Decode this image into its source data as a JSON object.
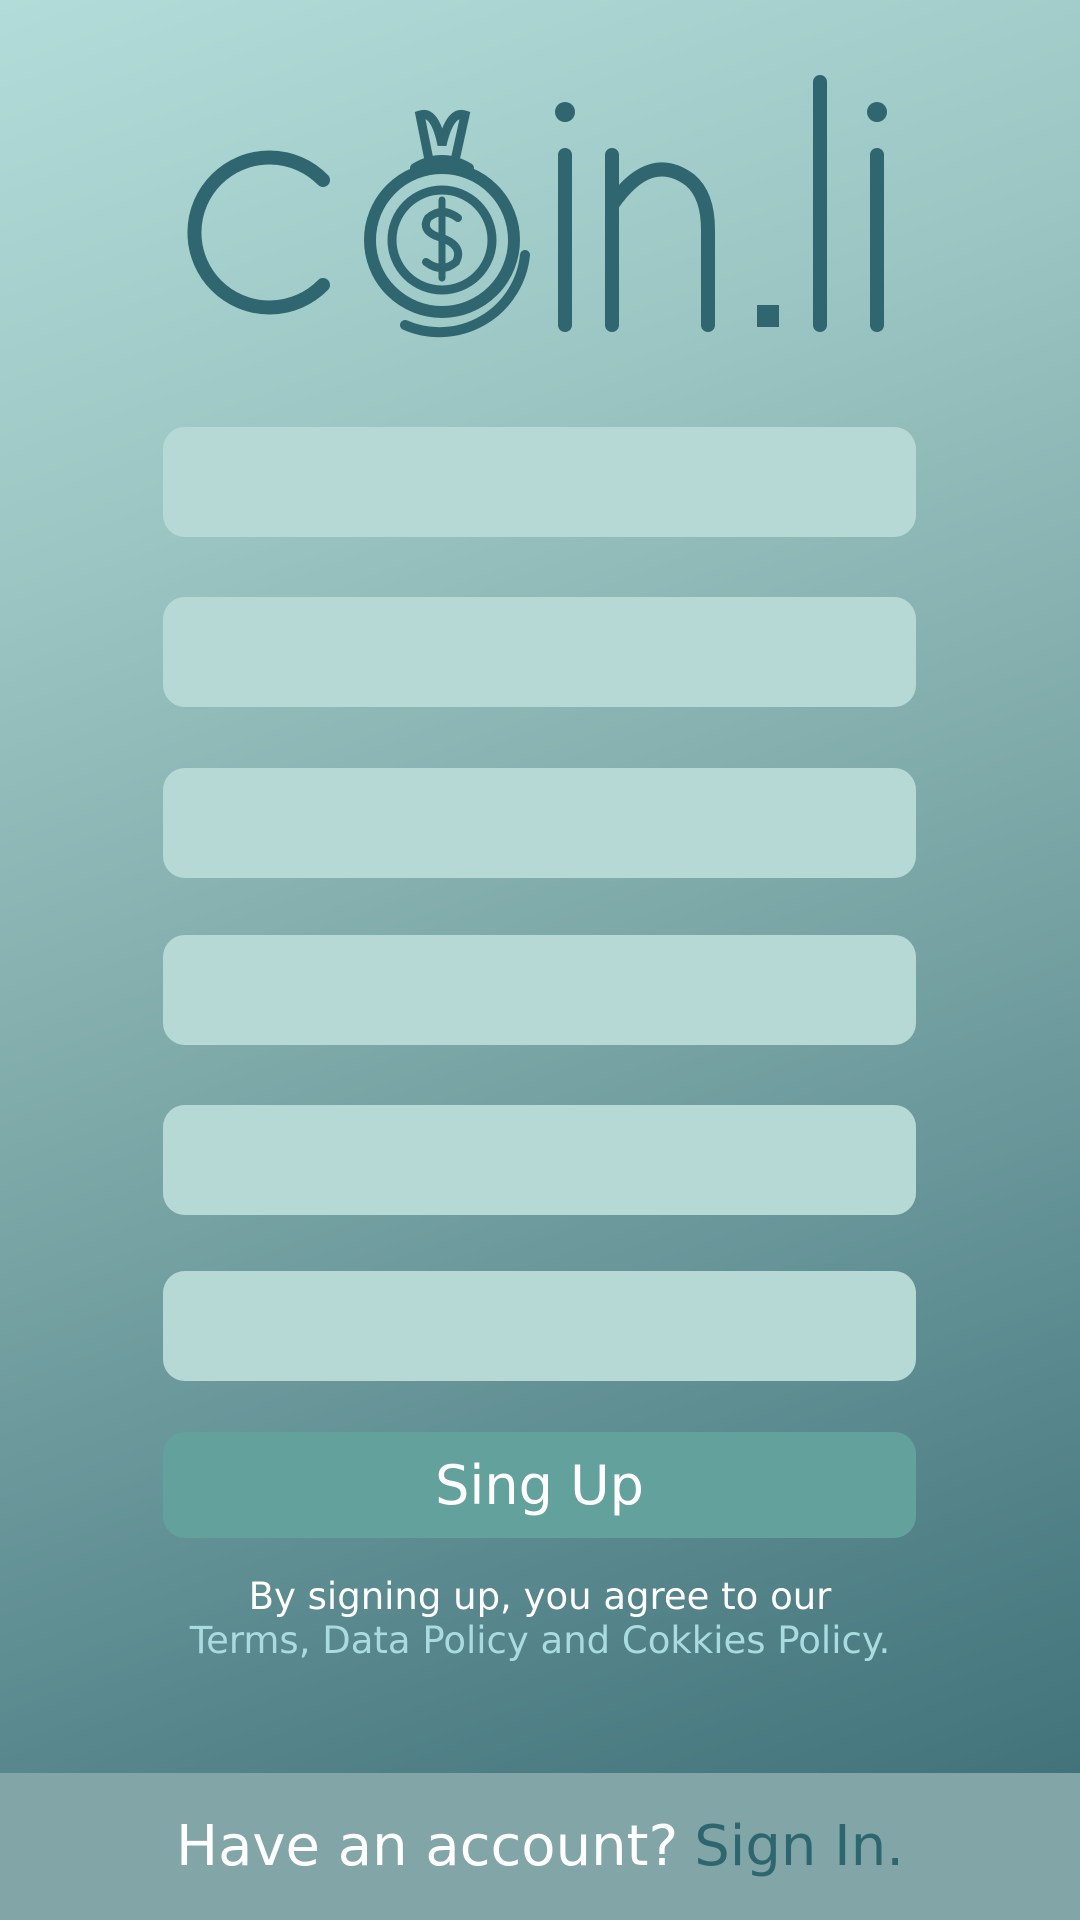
{
  "brand": {
    "name": "coin.li",
    "logo_color": "#2f6670"
  },
  "form": {
    "fields": [
      {
        "name": "signup-field-1",
        "value": "",
        "placeholder": ""
      },
      {
        "name": "signup-field-2",
        "value": "",
        "placeholder": ""
      },
      {
        "name": "signup-field-3",
        "value": "",
        "placeholder": ""
      },
      {
        "name": "signup-field-4",
        "value": "",
        "placeholder": ""
      },
      {
        "name": "signup-field-5",
        "value": "",
        "placeholder": ""
      },
      {
        "name": "signup-field-6",
        "value": "",
        "placeholder": ""
      }
    ],
    "submit_label": "Sing Up"
  },
  "legal": {
    "line1": "By signing up, you agree to our",
    "policy_link": "Terms, Data Policy and Cokkies Policy."
  },
  "footer": {
    "prompt": "Have an account?",
    "signin_link": "Sign In."
  },
  "colors": {
    "field_bg": "#b7d9d6",
    "button_bg": "#63a19d",
    "link": "#a9dbe0",
    "footer_bg": "#82a6a8"
  }
}
